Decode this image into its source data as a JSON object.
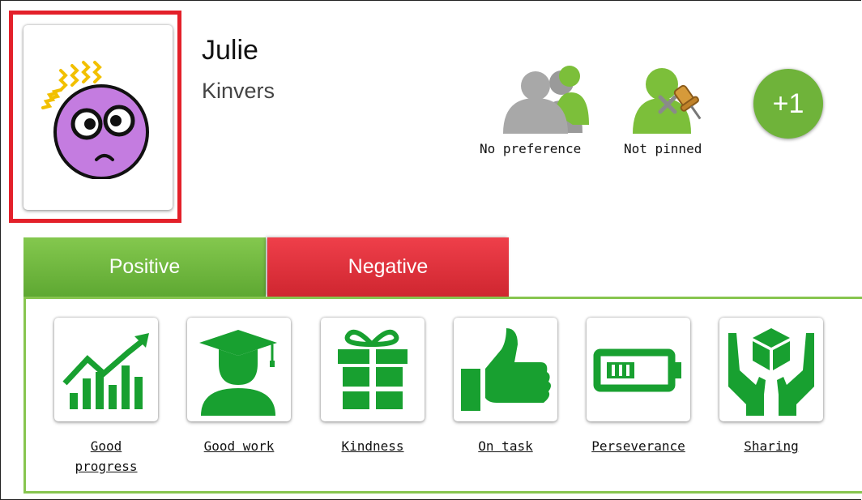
{
  "student": {
    "first_name": "Julie",
    "last_name": "Kinvers",
    "avatar_icon": "stressed-purple-face-icon"
  },
  "status": {
    "seating": {
      "label": "No preference",
      "icon": "people-group-icon"
    },
    "pin": {
      "label": "Not pinned",
      "icon": "pinned-user-icon"
    }
  },
  "award_button": {
    "label": "+1"
  },
  "tabs": [
    {
      "label": "Positive",
      "active": true,
      "color": "#6fb33a"
    },
    {
      "label": "Negative",
      "active": false,
      "color": "#e0303a"
    }
  ],
  "behaviours": [
    {
      "label": "Good progress",
      "label_lines": [
        "Good",
        "progress"
      ],
      "icon": "growth-chart-icon"
    },
    {
      "label": "Good work",
      "icon": "graduate-icon"
    },
    {
      "label": "Kindness",
      "icon": "gift-icon"
    },
    {
      "label": "On task",
      "icon": "thumbs-up-icon"
    },
    {
      "label": "Perseverance",
      "icon": "battery-icon"
    },
    {
      "label": "Sharing",
      "icon": "hands-holding-cube-icon"
    }
  ],
  "colors": {
    "accent_green": "#18a030",
    "highlight_red": "#e3202a"
  }
}
